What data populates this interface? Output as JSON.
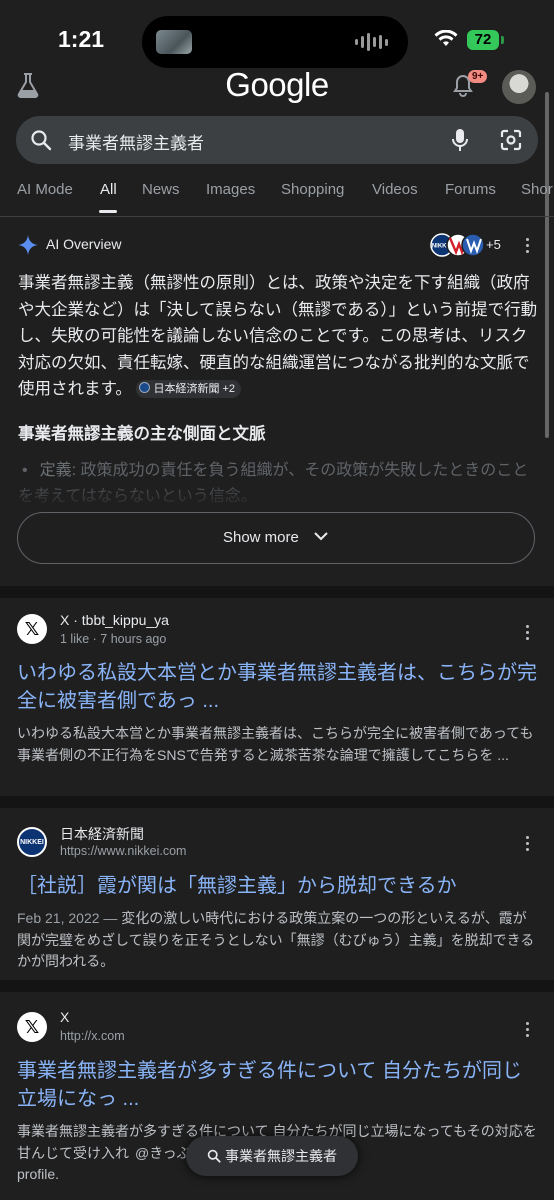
{
  "status": {
    "time": "1:21",
    "battery": "72"
  },
  "header": {
    "logo": "Google",
    "notifications": "9+"
  },
  "search": {
    "query": "事業者無謬主義者"
  },
  "tabs": [
    "AI Mode",
    "All",
    "News",
    "Images",
    "Shopping",
    "Videos",
    "Forums",
    "Shor"
  ],
  "active_tab": "All",
  "ai_overview": {
    "title": "AI Overview",
    "sources_more": "+5",
    "body": "事業者無謬主義（無謬性の原則）とは、政策や決定を下す組織（政府や大企業など）は「決して誤らない（無謬である）」という前提で行動し、失敗の可能性を議論しない信念のことです。この思考は、リスク対応の欠如、責任転嫁、硬直的な組織運営につながる批判的な文脈で使用されます。",
    "citation": "日本経済新聞 +2",
    "heading": "事業者無謬主義の主な側面と文脈",
    "bullet_label": "定義:",
    "bullet_text": " 政策成功の責任を負う組織が、その政策が失敗したときのことを考えてはならないという信念。",
    "show_more": "Show more"
  },
  "results": [
    {
      "site": "X · tbbt_kippu_ya",
      "sub": "1 like · 7 hours ago",
      "title": "いわゆる私設大本営とか事業者無謬主義者は、こちらが完全に被害者側であっ ...",
      "date": "",
      "snippet": "いわゆる私設大本営とか事業者無謬主義者は、こちらが完全に被害者側であっても事業者側の不正行為をSNSで告発すると滅茶苦茶な論理で擁護してこちらを ..."
    },
    {
      "site": "日本経済新聞",
      "sub": "https://www.nikkei.com",
      "title": "［社説］霞が関は「無謬主義」から脱却できるか",
      "date": "Feb 21, 2022 — ",
      "snippet": "変化の激しい時代における政策立案の一つの形といえるが、霞が関が完璧をめざして誤りを正そうとしない「無謬（むびゅう）主義」を脱却できるかが問われる。"
    },
    {
      "site": "X",
      "sub": "http://x.com",
      "title": "事業者無謬主義者が多すぎる件について 自分たちが同じ立場になっ ...",
      "date": "",
      "snippet": "事業者無謬主義者が多すぎる件について 自分たちが同じ立場になってもその対応を甘んじて受け入れ",
      "snippet_tail": "@きっぷ屋(交通・旅行垢)",
      "snippet_end": "profile."
    }
  ],
  "bottom_search": "事業者無謬主義者",
  "colors": {
    "background": "#1f1f1f",
    "link": "#8ab4f8",
    "battery": "#34c759"
  }
}
